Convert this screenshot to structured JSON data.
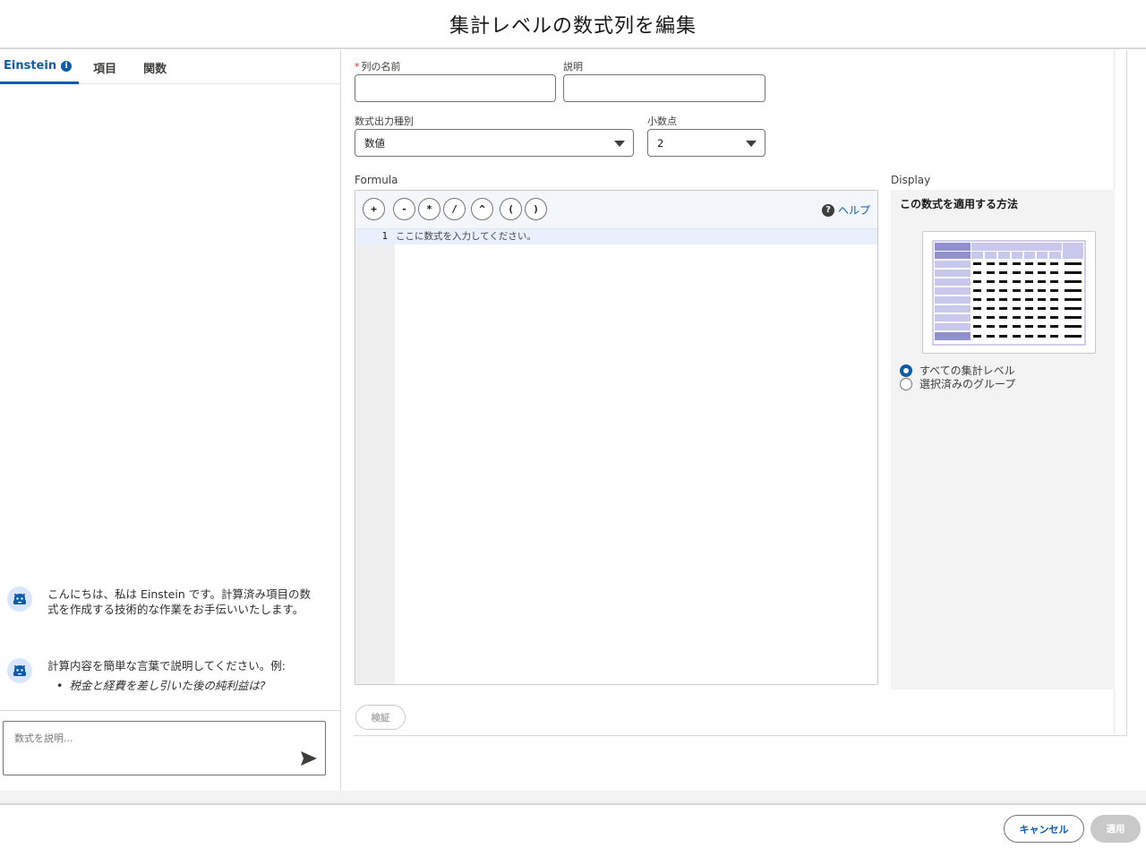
{
  "modal": {
    "title": "集計レベルの数式列を編集"
  },
  "left": {
    "tabs": [
      {
        "label": "Einstein"
      },
      {
        "label": "項目"
      },
      {
        "label": "関数"
      }
    ],
    "messages": [
      {
        "text": "こんにちは、私は Einstein です。計算済み項目の数式を作成する技術的な作業をお手伝いいたします。"
      },
      {
        "text": "計算内容を簡単な言葉で説明してください。例:",
        "example": "税金と経費を差し引いた後の純利益は?"
      }
    ],
    "input_placeholder": "数式を説明..."
  },
  "form": {
    "column_name_label": "列の名前",
    "description_label": "説明",
    "output_type_label": "数式出力種別",
    "output_type_value": "数値",
    "decimal_label": "小数点",
    "decimal_value": "2",
    "formula_label": "Formula",
    "display_label": "Display"
  },
  "formula": {
    "operators": [
      "+",
      "-",
      "*",
      "/",
      "^",
      "(",
      ")"
    ],
    "help_label": "ヘルプ",
    "line_number": "1",
    "placeholder": "ここに数式を入力してください。"
  },
  "display": {
    "title": "この数式を適用する方法",
    "options": [
      {
        "label": "すべての集計レベル",
        "checked": true
      },
      {
        "label": "選択済みのグループ",
        "checked": false
      }
    ]
  },
  "validate_label": "検証",
  "footer": {
    "cancel_label": "キャンセル",
    "apply_label": "適用"
  },
  "colors": {
    "brand": "#0b5cab",
    "preview_header": "#9f9fd6",
    "preview_light": "#c8c8ec"
  }
}
